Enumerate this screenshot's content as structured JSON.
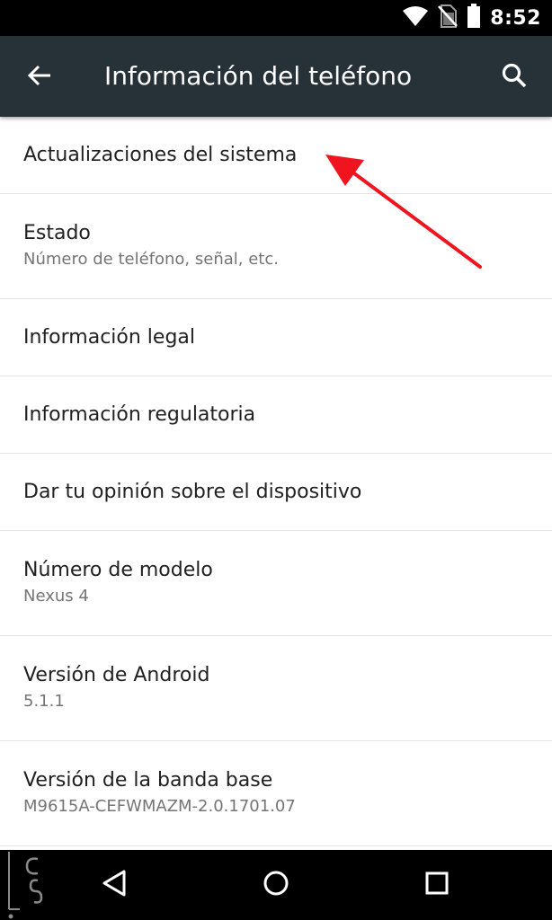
{
  "status_bar": {
    "time": "8:52",
    "icons": [
      "wifi-icon",
      "no-sim-icon",
      "battery-icon"
    ]
  },
  "app_bar": {
    "title": "Información del teléfono",
    "back_icon": "arrow-back-icon",
    "search_icon": "search-icon"
  },
  "items": [
    {
      "title": "Actualizaciones del sistema",
      "summary": ""
    },
    {
      "title": "Estado",
      "summary": "Número de teléfono, señal, etc."
    },
    {
      "title": "Información legal",
      "summary": ""
    },
    {
      "title": "Información regulatoria",
      "summary": ""
    },
    {
      "title": "Dar tu opinión sobre el dispositivo",
      "summary": ""
    },
    {
      "title": "Número de modelo",
      "summary": "Nexus 4"
    },
    {
      "title": "Versión de Android",
      "summary": "5.1.1"
    },
    {
      "title": "Versión de la banda base",
      "summary": "M9615A-CEFWMAZM-2.0.1701.07"
    }
  ],
  "nav_bar": {
    "icons": [
      "nav-back-icon",
      "nav-home-icon",
      "nav-recents-icon"
    ]
  },
  "colors": {
    "app_bar": "#263238",
    "status_bar": "#000000",
    "nav_bar": "#000000",
    "annotation_arrow": "#f0141e",
    "primary_text": "#212121",
    "secondary_text": "#757575"
  }
}
